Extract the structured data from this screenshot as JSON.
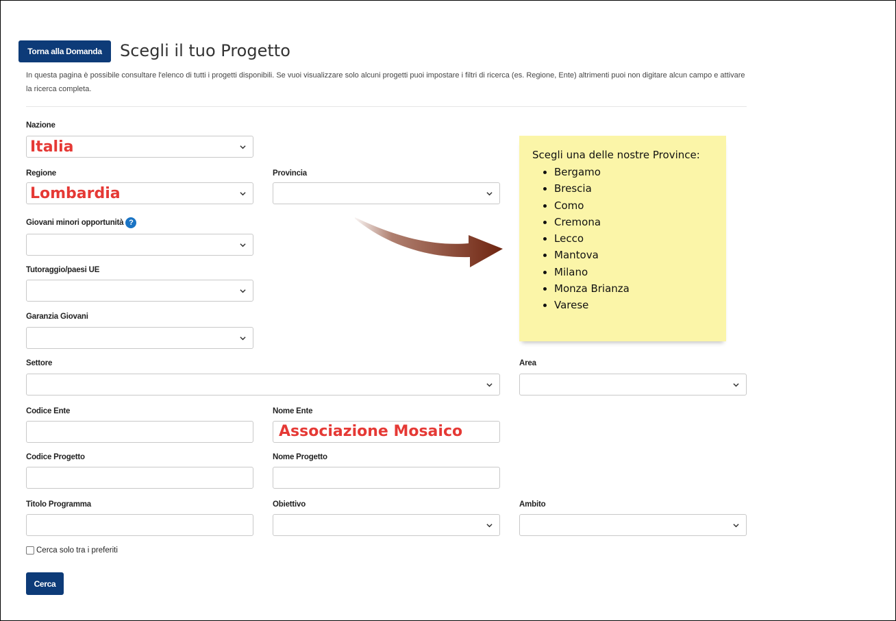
{
  "header": {
    "back_button": "Torna alla Domanda",
    "title": "Scegli il tuo Progetto",
    "intro": "In questa pagina è possibile consultare l'elenco di tutti i progetti disponibili. Se vuoi visualizzare solo alcuni progetti puoi impostare i filtri di ricerca (es. Regione, Ente) altrimenti puoi non digitare alcun campo e attivare la ricerca completa."
  },
  "form": {
    "nazione": {
      "label": "Nazione",
      "value": "Italia"
    },
    "regione": {
      "label": "Regione",
      "value": "Lombardia"
    },
    "provincia": {
      "label": "Provincia",
      "value": ""
    },
    "giovani": {
      "label": "Giovani minori opportunità",
      "value": ""
    },
    "tutoraggio": {
      "label": "Tutoraggio/paesi UE",
      "value": ""
    },
    "garanzia": {
      "label": "Garanzia Giovani",
      "value": ""
    },
    "settore": {
      "label": "Settore",
      "value": ""
    },
    "area": {
      "label": "Area",
      "value": ""
    },
    "codice_ente": {
      "label": "Codice Ente",
      "value": ""
    },
    "nome_ente": {
      "label": "Nome Ente",
      "value": "Associazione Mosaico"
    },
    "codice_progetto": {
      "label": "Codice Progetto",
      "value": ""
    },
    "nome_progetto": {
      "label": "Nome Progetto",
      "value": ""
    },
    "titolo_programma": {
      "label": "Titolo Programma",
      "value": ""
    },
    "obiettivo": {
      "label": "Obiettivo",
      "value": ""
    },
    "ambito": {
      "label": "Ambito",
      "value": ""
    },
    "preferiti": {
      "label": "Cerca solo tra i preferiti",
      "checked": false
    },
    "search_button": "Cerca"
  },
  "note": {
    "title": "Scegli una delle nostre Province:",
    "items": [
      "Bergamo",
      "Brescia",
      "Como",
      "Cremona",
      "Lecco",
      "Mantova",
      "Milano",
      "Monza Brianza",
      "Varese"
    ]
  },
  "icons": {
    "help": "question-circle-icon",
    "chevron": "chevron-down-icon",
    "arrow": "curved-arrow-icon"
  },
  "colors": {
    "primary": "#0d3b78",
    "annotation": "#e53935",
    "note_bg": "#fbf5a8",
    "arrow": "#7a2a10",
    "help_icon": "#1a74c4"
  }
}
